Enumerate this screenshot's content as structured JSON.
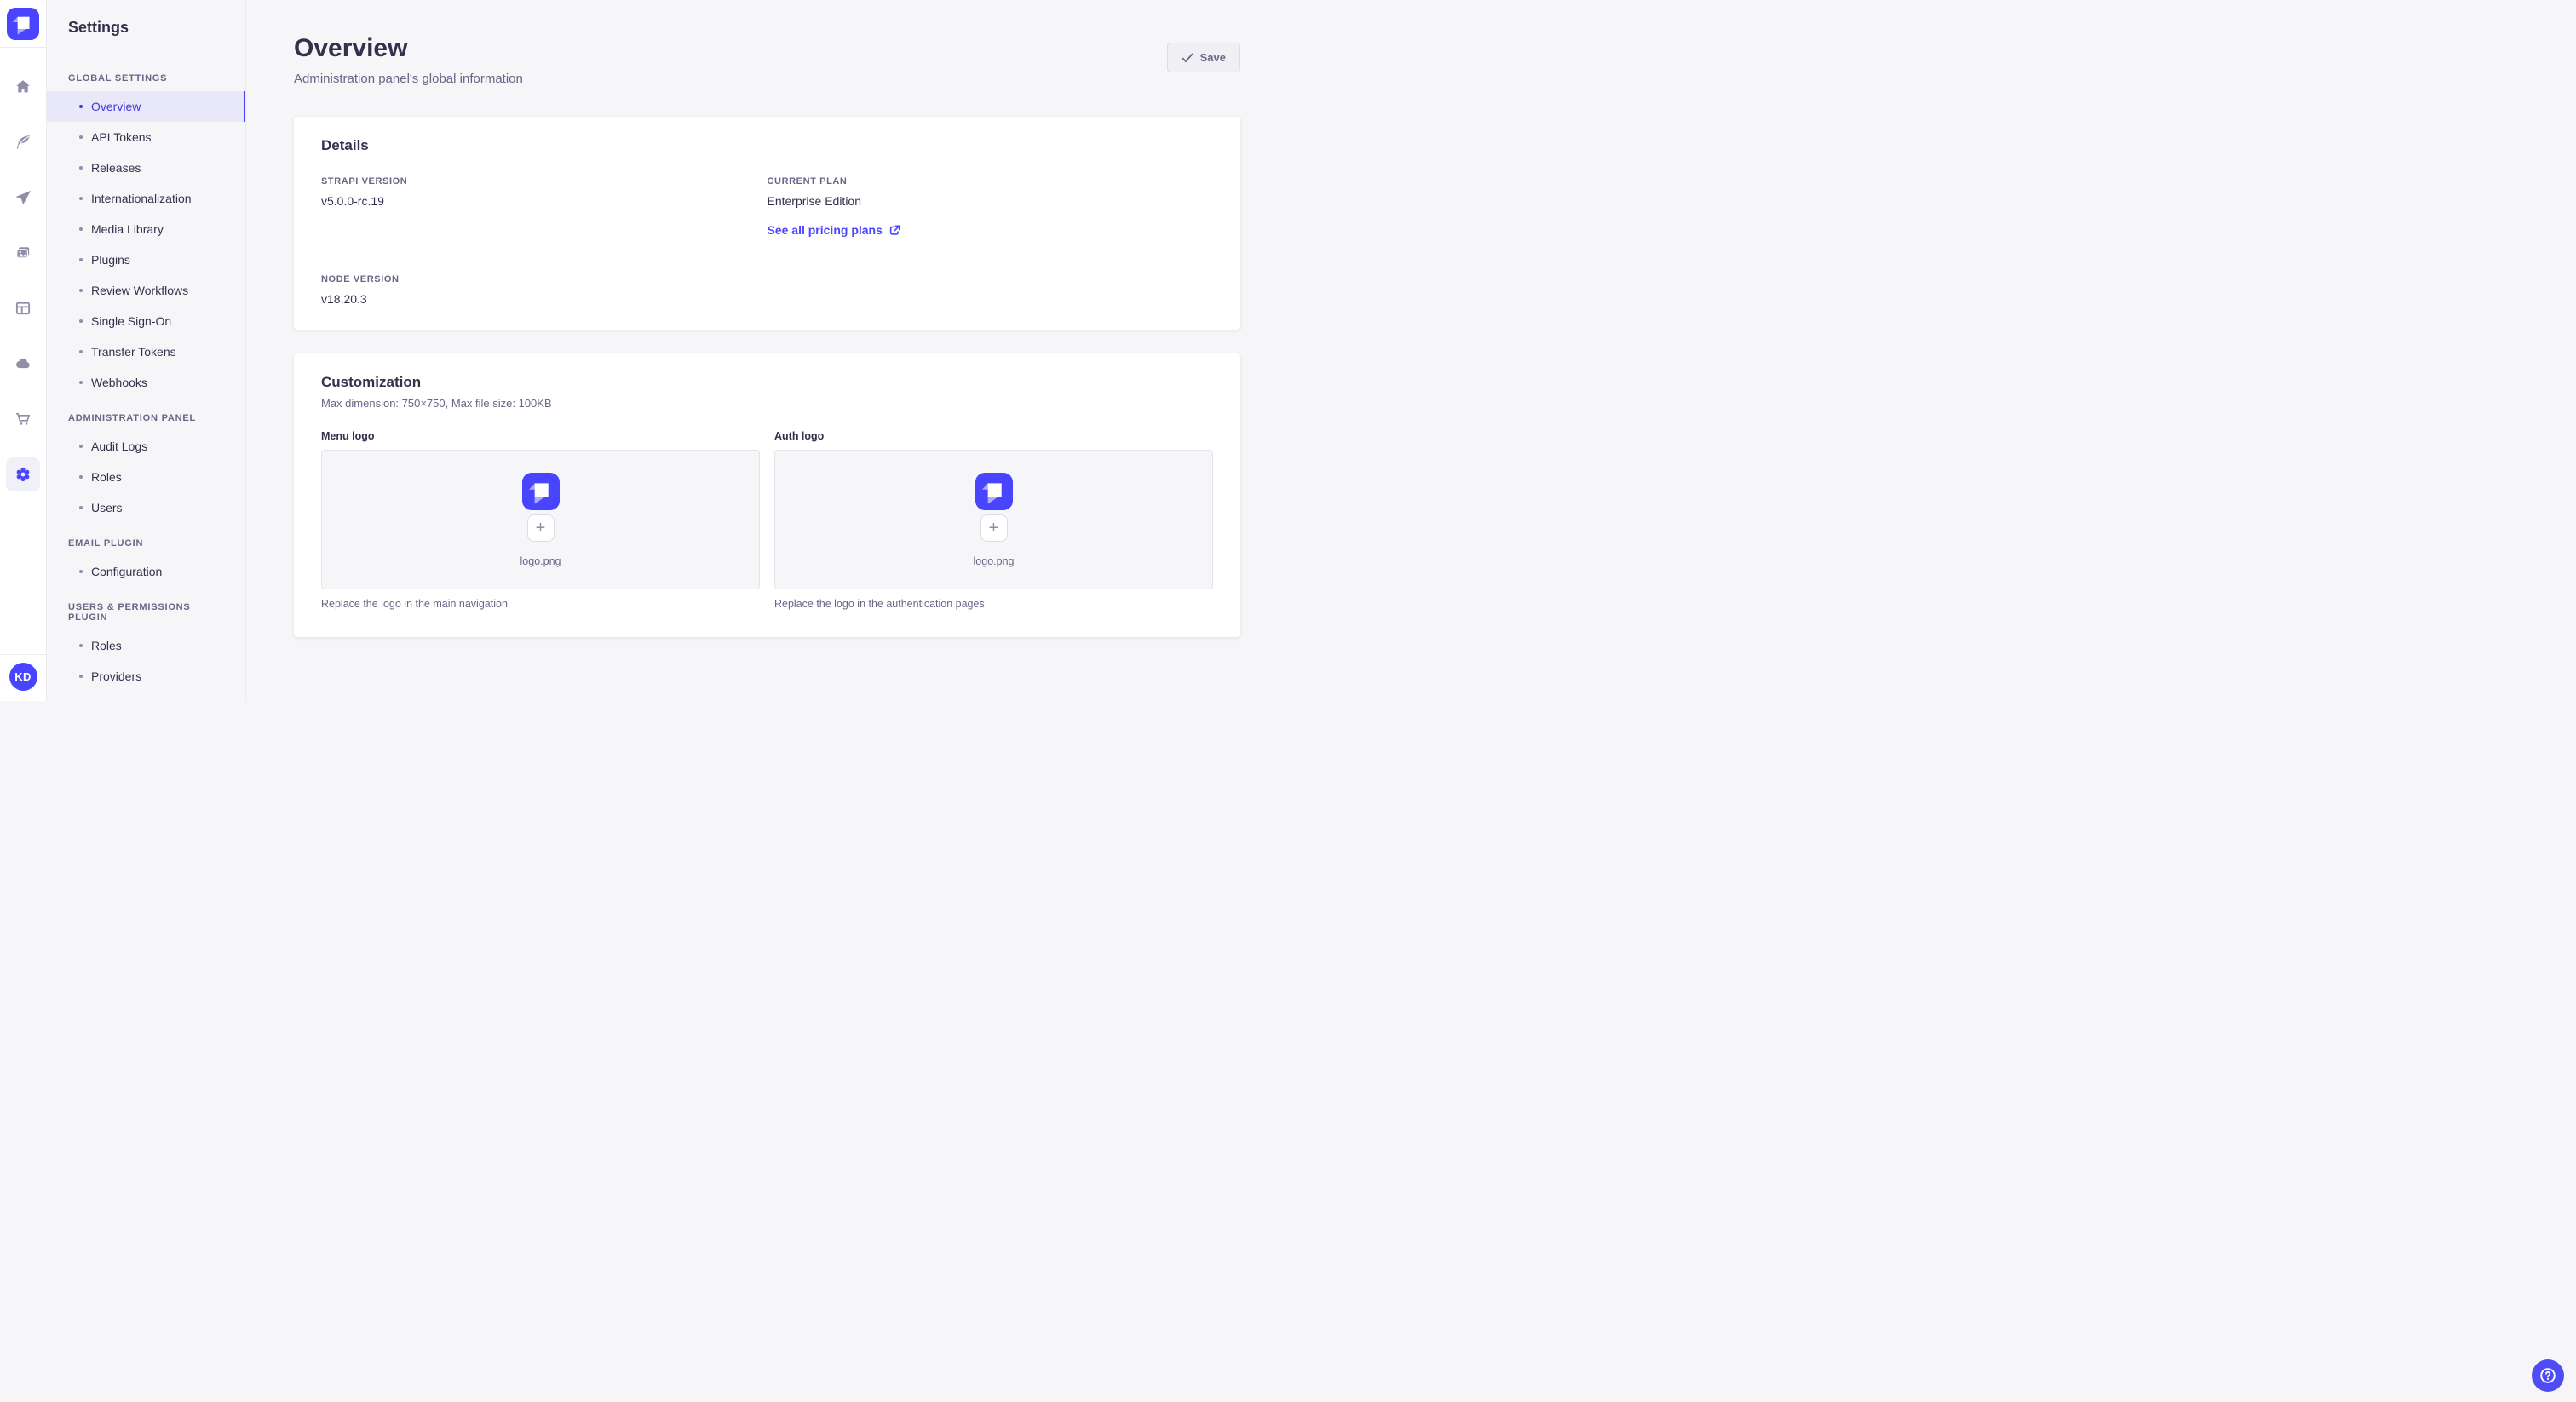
{
  "colors": {
    "accent": "#4945ff",
    "accent_text": "#4437e0",
    "selected_bg": "#e9e8f9",
    "text": "#32324d",
    "text_secondary": "#666687",
    "rail_icon": "#8e8ea9"
  },
  "icons": {
    "rail": [
      "home-icon",
      "feather-icon",
      "paper-plane-icon",
      "media-library-icon",
      "layout-icon",
      "cloud-icon",
      "cart-icon",
      "gear-icon"
    ],
    "active_rail_icon": "gear-icon",
    "save": "check-icon",
    "pricing": "external-link-icon",
    "upload": "plus-icon",
    "help": "question-mark-icon",
    "brand": "strapi-logo"
  },
  "rail": {
    "avatar_initials": "KD"
  },
  "sidebar": {
    "title": "Settings",
    "sections": [
      {
        "label": "GLOBAL SETTINGS",
        "items": [
          {
            "label": "Overview",
            "active": true
          },
          {
            "label": "API Tokens"
          },
          {
            "label": "Releases"
          },
          {
            "label": "Internationalization"
          },
          {
            "label": "Media Library"
          },
          {
            "label": "Plugins"
          },
          {
            "label": "Review Workflows"
          },
          {
            "label": "Single Sign-On"
          },
          {
            "label": "Transfer Tokens"
          },
          {
            "label": "Webhooks"
          }
        ]
      },
      {
        "label": "ADMINISTRATION PANEL",
        "items": [
          {
            "label": "Audit Logs"
          },
          {
            "label": "Roles"
          },
          {
            "label": "Users"
          }
        ]
      },
      {
        "label": "EMAIL PLUGIN",
        "items": [
          {
            "label": "Configuration"
          }
        ]
      },
      {
        "label": "USERS & PERMISSIONS PLUGIN",
        "items": [
          {
            "label": "Roles"
          },
          {
            "label": "Providers"
          }
        ]
      }
    ]
  },
  "header": {
    "title": "Overview",
    "subtitle": "Administration panel's global information",
    "save_label": "Save"
  },
  "details": {
    "heading": "Details",
    "strapi_version_label": "STRAPI VERSION",
    "strapi_version": "v5.0.0-rc.19",
    "current_plan_label": "CURRENT PLAN",
    "current_plan": "Enterprise Edition",
    "pricing_link_label": "See all pricing plans",
    "node_version_label": "NODE VERSION",
    "node_version": "v18.20.3"
  },
  "customization": {
    "heading": "Customization",
    "constraints": "Max dimension: 750×750, Max file size: 100KB",
    "menu_logo": {
      "label": "Menu logo",
      "filename": "logo.png",
      "plus_glyph": "+",
      "hint": "Replace the logo in the main navigation"
    },
    "auth_logo": {
      "label": "Auth logo",
      "filename": "logo.png",
      "plus_glyph": "+",
      "hint": "Replace the logo in the authentication pages"
    }
  }
}
